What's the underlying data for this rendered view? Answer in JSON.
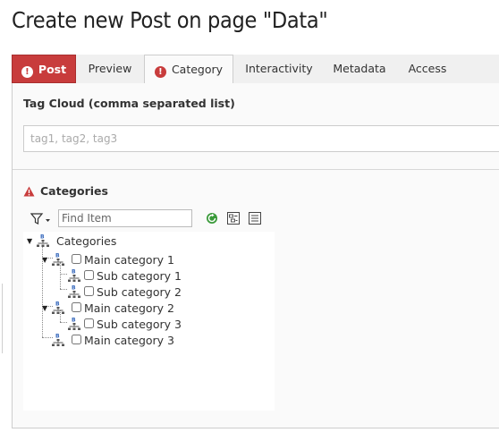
{
  "page": {
    "title": "Create new Post on page \"Data\""
  },
  "tabs": [
    {
      "label": "Post",
      "state": "error"
    },
    {
      "label": "Preview",
      "state": "normal"
    },
    {
      "label": "Category",
      "state": "active-error"
    },
    {
      "label": "Interactivity",
      "state": "normal"
    },
    {
      "label": "Metadata",
      "state": "normal"
    },
    {
      "label": "Access",
      "state": "normal"
    }
  ],
  "tag_cloud": {
    "label": "Tag Cloud (comma separated list)",
    "value": "",
    "placeholder": "tag1, tag2, tag3"
  },
  "categories": {
    "label": "Categories",
    "find_placeholder": "Find Item",
    "tree": [
      {
        "label": "Categories",
        "checkbox": false,
        "expanded": true
      },
      {
        "label": "Main category 1",
        "checkbox": true,
        "checked": false,
        "expanded": true
      },
      {
        "label": "Sub category 1",
        "checkbox": true,
        "checked": false
      },
      {
        "label": "Sub category 2",
        "checkbox": true,
        "checked": false
      },
      {
        "label": "Main category 2",
        "checkbox": true,
        "checked": false,
        "expanded": true
      },
      {
        "label": "Sub category 3",
        "checkbox": true,
        "checked": false
      },
      {
        "label": "Main category 3",
        "checkbox": true,
        "checked": false
      }
    ]
  },
  "icons": {
    "error": "exclamation-circle-icon",
    "warning": "warning-triangle-icon",
    "filter": "filter-icon",
    "refresh": "refresh-icon",
    "expand_all": "expand-all-icon",
    "collapse_all": "collapse-all-icon",
    "category_node": "category-tree-icon"
  },
  "colors": {
    "error": "#c83c3c",
    "refresh": "#3a9a3a"
  }
}
